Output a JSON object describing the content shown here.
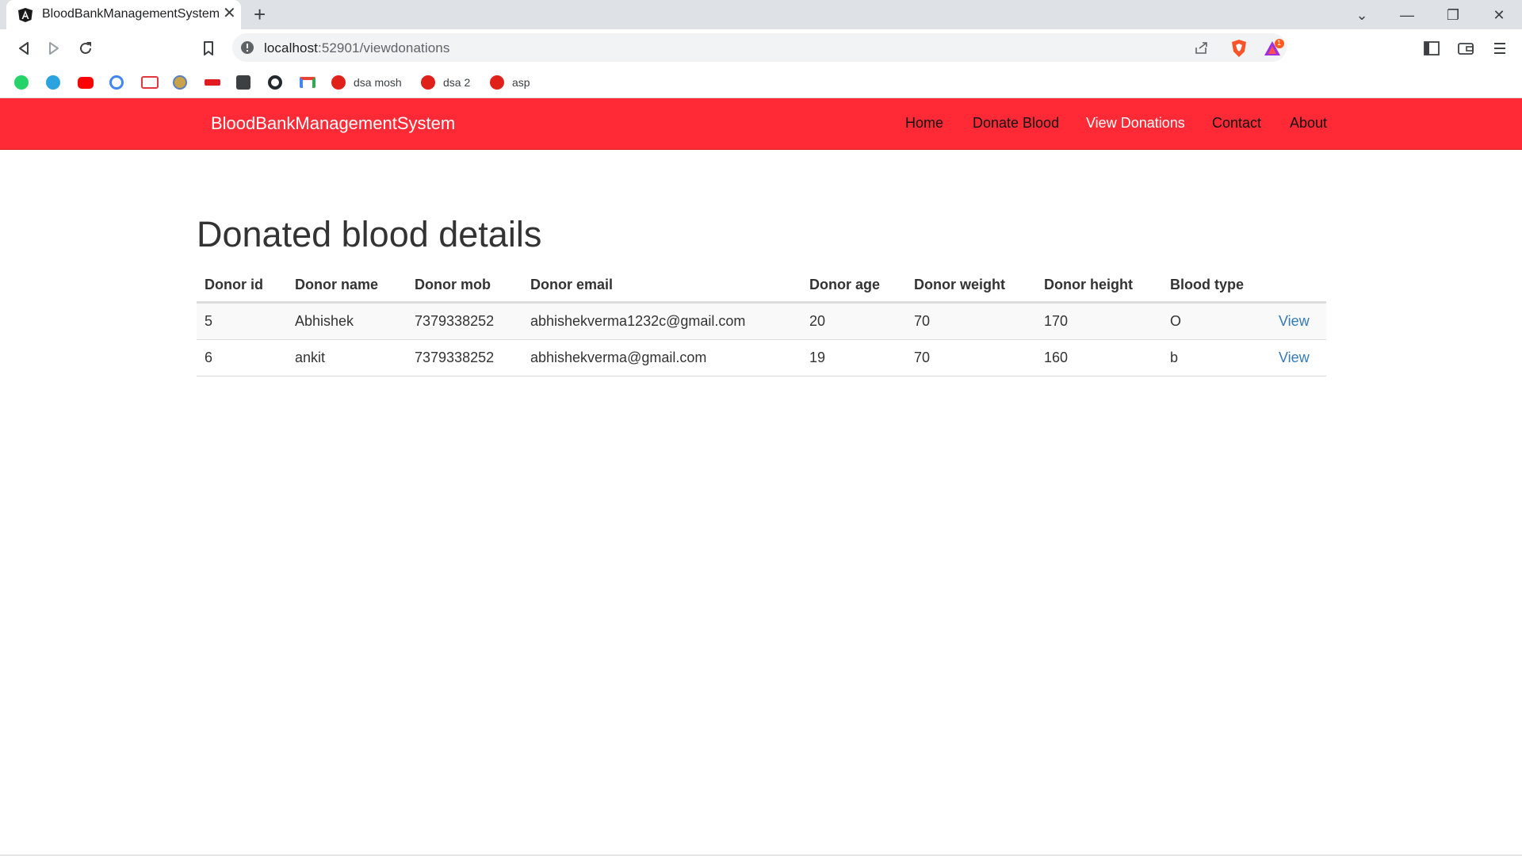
{
  "browser": {
    "tab_title": "BloodBankManagementSystem",
    "url_host": "localhost",
    "url_path": ":52901/viewdonations",
    "bookmarks": [
      {
        "icon": "whatsapp-icon",
        "label": ""
      },
      {
        "icon": "telegram-icon",
        "label": ""
      },
      {
        "icon": "youtube-icon",
        "label": ""
      },
      {
        "icon": "google-icon",
        "label": ""
      },
      {
        "icon": "tcs-icon",
        "label": ""
      },
      {
        "icon": "globe-icon",
        "label": ""
      },
      {
        "icon": "aon-icon",
        "label": ""
      },
      {
        "icon": "contacts-icon",
        "label": ""
      },
      {
        "icon": "github-icon",
        "label": ""
      },
      {
        "icon": "gmail-icon",
        "label": ""
      },
      {
        "icon": "mosh-icon",
        "label": "dsa mosh"
      },
      {
        "icon": "mosh-icon",
        "label": "dsa 2"
      },
      {
        "icon": "mosh-icon",
        "label": "asp"
      }
    ],
    "rewards_badge": "1"
  },
  "app": {
    "brand": "BloodBankManagementSystem",
    "nav": [
      {
        "label": "Home",
        "active": false
      },
      {
        "label": "Donate Blood",
        "active": false
      },
      {
        "label": "View Donations",
        "active": true
      },
      {
        "label": "Contact",
        "active": false
      },
      {
        "label": "About",
        "active": false
      }
    ]
  },
  "page": {
    "title": "Donated blood details",
    "columns": [
      "Donor id",
      "Donor name",
      "Donor mob",
      "Donor email",
      "Donor age",
      "Donor weight",
      "Donor height",
      "Blood type",
      ""
    ],
    "rows": [
      {
        "id": "5",
        "name": "Abhishek",
        "mob": "7379338252",
        "email": "abhishekverma1232c@gmail.com",
        "age": "20",
        "weight": "70",
        "height": "170",
        "blood_type": "O",
        "action": "View"
      },
      {
        "id": "6",
        "name": "ankit",
        "mob": "7379338252",
        "email": "abhishekverma@gmail.com",
        "age": "19",
        "weight": "70",
        "height": "160",
        "blood_type": "b",
        "action": "View"
      }
    ]
  },
  "colors": {
    "navbar": "#ff2a35",
    "link": "#337ab7"
  }
}
